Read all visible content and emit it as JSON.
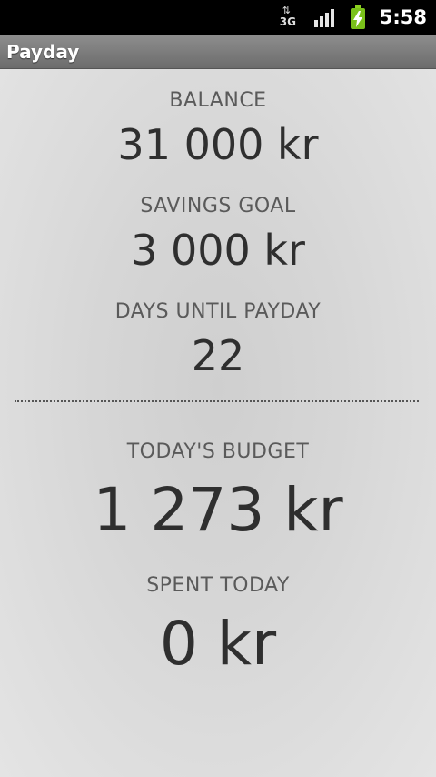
{
  "status_bar": {
    "network_label": "3G",
    "time": "5:58",
    "icons": [
      "data-transfer-icon",
      "signal-strength-icon",
      "battery-charging-icon"
    ]
  },
  "title_bar": {
    "title": "Payday"
  },
  "stats": {
    "balance": {
      "label": "BALANCE",
      "value": "31 000 kr"
    },
    "savings_goal": {
      "label": "SAVINGS GOAL",
      "value": "3 000 kr"
    },
    "days_until_payday": {
      "label": "DAYS UNTIL PAYDAY",
      "value": "22"
    },
    "todays_budget": {
      "label": "TODAY'S BUDGET",
      "value": "1 273 kr"
    },
    "spent_today": {
      "label": "SPENT TODAY",
      "value": "0 kr"
    }
  },
  "colors": {
    "status_bar": "#000000",
    "title_bar": "#7c7c7c",
    "background": "#d8d8d8",
    "label_text": "#5a5a5a",
    "value_text": "#2f2f2f",
    "battery": "#7ac11a"
  }
}
